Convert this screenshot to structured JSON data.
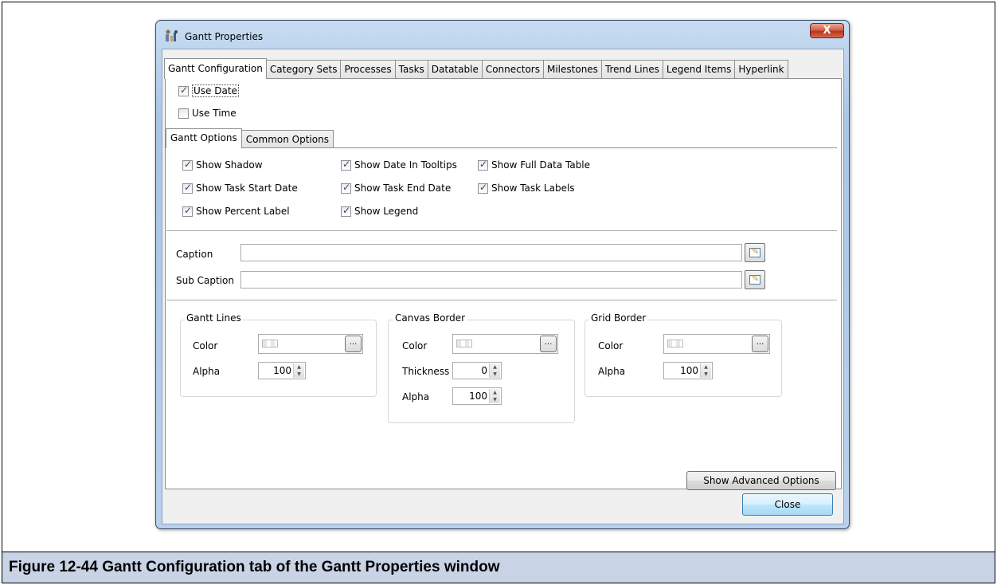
{
  "window": {
    "title": "Gantt Properties",
    "close_glyph": "X"
  },
  "tabs": [
    {
      "label": "Gantt Configuration",
      "active": true
    },
    {
      "label": "Category Sets"
    },
    {
      "label": "Processes"
    },
    {
      "label": "Tasks"
    },
    {
      "label": "Datatable"
    },
    {
      "label": "Connectors"
    },
    {
      "label": "Milestones"
    },
    {
      "label": "Trend Lines"
    },
    {
      "label": "Legend Items"
    },
    {
      "label": "Hyperlink"
    }
  ],
  "top_options": {
    "use_date": {
      "label": "Use Date",
      "checked": true
    },
    "use_time": {
      "label": "Use Time",
      "checked": false
    }
  },
  "sub_tabs": [
    {
      "label": "Gantt Options",
      "active": true
    },
    {
      "label": "Common Options"
    }
  ],
  "gantt_options": {
    "show_shadow": {
      "label": "Show Shadow",
      "checked": true
    },
    "show_date_in_tooltips": {
      "label": "Show Date In Tooltips",
      "checked": true
    },
    "show_full_data_table": {
      "label": "Show Full Data Table",
      "checked": true
    },
    "show_task_start_date": {
      "label": "Show Task Start Date",
      "checked": true
    },
    "show_task_end_date": {
      "label": "Show Task End Date",
      "checked": true
    },
    "show_task_labels": {
      "label": "Show Task Labels",
      "checked": true
    },
    "show_percent_label": {
      "label": "Show Percent Label",
      "checked": true
    },
    "show_legend": {
      "label": "Show Legend",
      "checked": true
    }
  },
  "captions": {
    "caption_label": "Caption",
    "caption_value": "",
    "sub_caption_label": "Sub Caption",
    "sub_caption_value": ""
  },
  "gantt_lines": {
    "title": "Gantt Lines",
    "color_label": "Color",
    "alpha_label": "Alpha",
    "alpha_value": "100",
    "dots": "..."
  },
  "canvas_border": {
    "title": "Canvas Border",
    "color_label": "Color",
    "thickness_label": "Thickness",
    "thickness_value": "0",
    "alpha_label": "Alpha",
    "alpha_value": "100",
    "dots": "..."
  },
  "grid_border": {
    "title": "Grid Border",
    "color_label": "Color",
    "alpha_label": "Alpha",
    "alpha_value": "100",
    "dots": "..."
  },
  "buttons": {
    "advanced": "Show Advanced Options",
    "close": "Close"
  },
  "figure_caption": "Figure 12-44  Gantt Configuration tab of the Gantt Properties window",
  "colors": {
    "titlebar": "#b9d1ec",
    "close_button": "#c9452c",
    "caption_bar": "#c9d3e6"
  }
}
